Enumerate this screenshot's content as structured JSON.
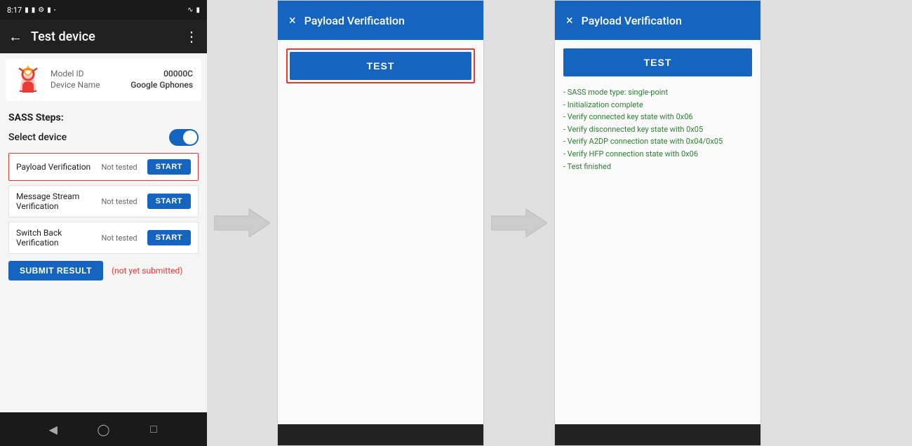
{
  "phone": {
    "status_time": "8:17",
    "toolbar_title": "Test device",
    "device_model_label": "Model ID",
    "device_model_value": "00000C",
    "device_name_label": "Device Name",
    "device_name_value": "Google Gphones",
    "sass_title": "SASS Steps:",
    "select_device_label": "Select device",
    "steps": [
      {
        "name": "Payload Verification",
        "status": "Not tested",
        "btn_label": "START",
        "highlighted": true
      },
      {
        "name": "Message Stream Verification",
        "status": "Not tested",
        "btn_label": "START",
        "highlighted": false
      },
      {
        "name": "Switch Back Verification",
        "status": "Not tested",
        "btn_label": "START",
        "highlighted": false
      }
    ],
    "submit_btn_label": "SUBMIT RESULT",
    "submit_status": "(not yet submitted)"
  },
  "dialog1": {
    "title": "Payload Verification",
    "close_icon": "×",
    "test_btn_label": "TEST"
  },
  "dialog2": {
    "title": "Payload Verification",
    "close_icon": "×",
    "test_btn_label": "TEST",
    "results": [
      "- SASS mode type: single-point",
      "- Initialization complete",
      "- Verify connected key state with 0x06",
      "- Verify disconnected key state with 0x05",
      "- Verify A2DP connection state with 0x04/0x05",
      "- Verify HFP connection state with 0x06",
      "- Test finished"
    ]
  }
}
